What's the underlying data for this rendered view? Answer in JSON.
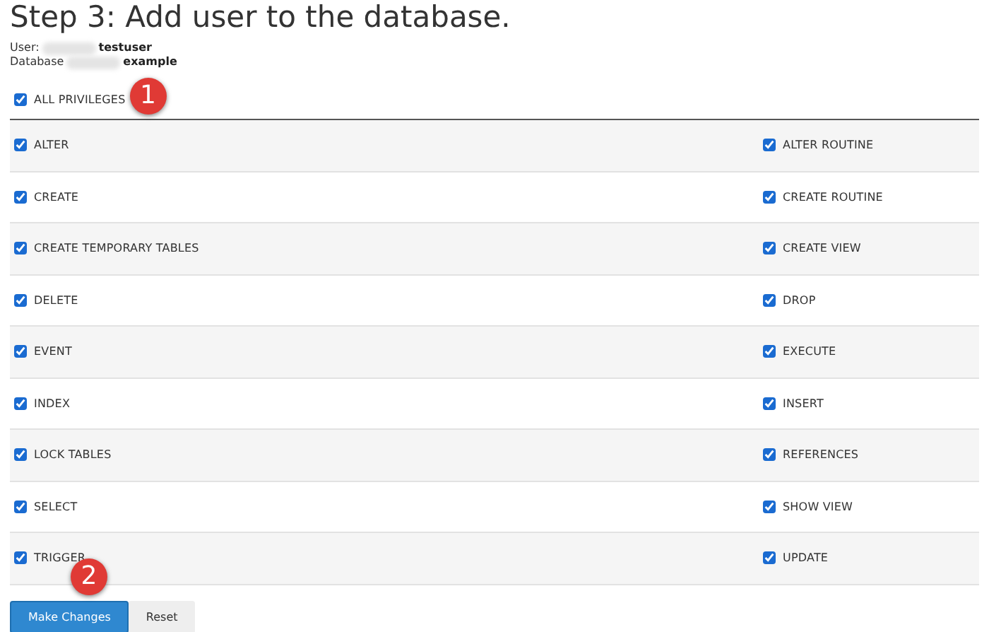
{
  "title": "Step 3: Add user to the database.",
  "user": {
    "label": "User:",
    "value": "testuser"
  },
  "database": {
    "label": "Database",
    "value": "example"
  },
  "all_privileges": {
    "label": "ALL PRIVILEGES",
    "checked": true,
    "callout": "1"
  },
  "privileges": [
    {
      "label": "ALTER",
      "checked": true
    },
    {
      "label": "ALTER ROUTINE",
      "checked": true
    },
    {
      "label": "CREATE",
      "checked": true
    },
    {
      "label": "CREATE ROUTINE",
      "checked": true
    },
    {
      "label": "CREATE TEMPORARY TABLES",
      "checked": true
    },
    {
      "label": "CREATE VIEW",
      "checked": true
    },
    {
      "label": "DELETE",
      "checked": true
    },
    {
      "label": "DROP",
      "checked": true
    },
    {
      "label": "EVENT",
      "checked": true
    },
    {
      "label": "EXECUTE",
      "checked": true
    },
    {
      "label": "INDEX",
      "checked": true
    },
    {
      "label": "INSERT",
      "checked": true
    },
    {
      "label": "LOCK TABLES",
      "checked": true
    },
    {
      "label": "REFERENCES",
      "checked": true
    },
    {
      "label": "SELECT",
      "checked": true
    },
    {
      "label": "SHOW VIEW",
      "checked": true
    },
    {
      "label": "TRIGGER",
      "checked": true
    },
    {
      "label": "UPDATE",
      "checked": true
    }
  ],
  "buttons": [
    {
      "label": "Make Changes",
      "kind": "primary",
      "callout": "2"
    },
    {
      "label": "Reset",
      "kind": "secondary"
    }
  ]
}
